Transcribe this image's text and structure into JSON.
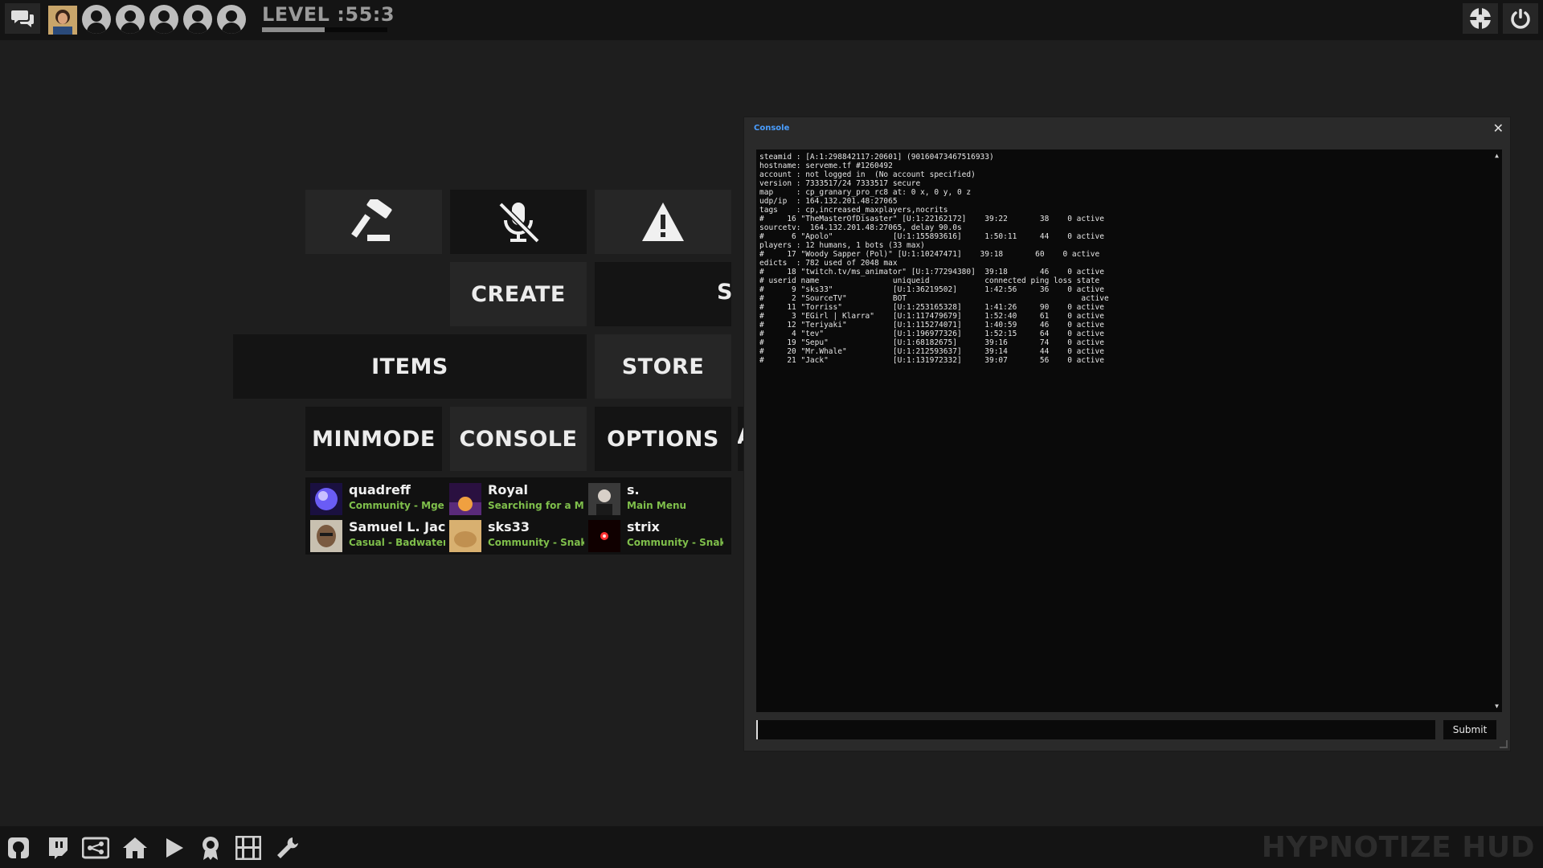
{
  "topbar": {
    "level_text": "LEVEL :55:3",
    "level_progress": 0.5,
    "party_slots": 5,
    "icons": {
      "chat": "chat-icon",
      "logo": "tf2-logo-icon",
      "power": "power-icon"
    }
  },
  "menu": {
    "create": "CREATE",
    "servers_partial": "SER",
    "items": "ITEMS",
    "store": "STORE",
    "minmode": "MINMODE",
    "console": "CONSOLE",
    "options": "OPTIONS",
    "achievements_partial": "A",
    "icons": [
      "hammer-icon",
      "mic-muted-icon",
      "warning-icon"
    ]
  },
  "friends": [
    {
      "name": "quadreff",
      "status": "Community - Mge ...",
      "avatar_color": "#6a5cf5"
    },
    {
      "name": "Royal",
      "status": "Searching for a M...",
      "avatar_color": "#5a2a7a"
    },
    {
      "name": "s.",
      "status": "Main Menu",
      "avatar_color": "#3a3a3a"
    },
    {
      "name": "Samuel L. Jac...",
      "status": "Casual - Badwater ...",
      "avatar_color": "#7a5a40"
    },
    {
      "name": "sks33",
      "status": "Community - Snak...",
      "avatar_color": "#d8b070"
    },
    {
      "name": "strix",
      "status": "Community - Snak...",
      "avatar_color": "#2a0000"
    }
  ],
  "console": {
    "title": "Console",
    "close": "✕",
    "submit": "Submit",
    "input_value": "",
    "lines": [
      "steamid : [A:1:298842117:20601] (90160473467516933)",
      "hostname: serveme.tf #1260492",
      "account : not logged in  (No account specified)",
      "version : 7333517/24 7333517 secure",
      "map     : cp_granary_pro_rc8 at: 0 x, 0 y, 0 z",
      "udp/ip  : 164.132.201.48:27065",
      "tags    : cp,increased_maxplayers,nocrits",
      "#     16 \"TheMasterOfDisaster\" [U:1:22162172]    39:22       38    0 active",
      "sourcetv:  164.132.201.48:27065, delay 90.0s",
      "#      6 \"Apolo\"             [U:1:155893616]     1:50:11     44    0 active",
      "players : 12 humans, 1 bots (33 max)",
      "#     17 \"Woody Sapper (Pol)\" [U:1:10247471]    39:18       60    0 active",
      "edicts  : 782 used of 2048 max",
      "#     18 \"twitch.tv/ms_animator\" [U:1:77294380]  39:18       46    0 active",
      "# userid name                uniqueid            connected ping loss state",
      "#      9 \"sks33\"             [U:1:36219502]      1:42:56     36    0 active",
      "#      2 \"SourceTV\"          BOT                                      active",
      "#     11 \"Torriss\"           [U:1:253165328]     1:41:26     90    0 active",
      "#      3 \"EGirl | Klarra\"    [U:1:117479679]     1:52:40     61    0 active",
      "#     12 \"Teriyaki\"          [U:1:115274071]     1:40:59     46    0 active",
      "#      4 \"tev\"               [U:1:196977326]     1:52:15     64    0 active",
      "#     19 \"Sepu\"              [U:1:68182675]      39:16       74    0 active",
      "#     20 \"Mr.Whale\"          [U:1:212593637]     39:14       44    0 active",
      "#     21 \"Jack\"              [U:1:131972332]     39:07       56    0 active"
    ]
  },
  "bottombar": {
    "icons": [
      "github-icon",
      "twitch-icon",
      "server-browser-icon",
      "home-icon",
      "play-icon",
      "achievement-medal-icon",
      "film-icon",
      "wrench-icon"
    ],
    "brand": "HYPNOTIZE HUD"
  }
}
